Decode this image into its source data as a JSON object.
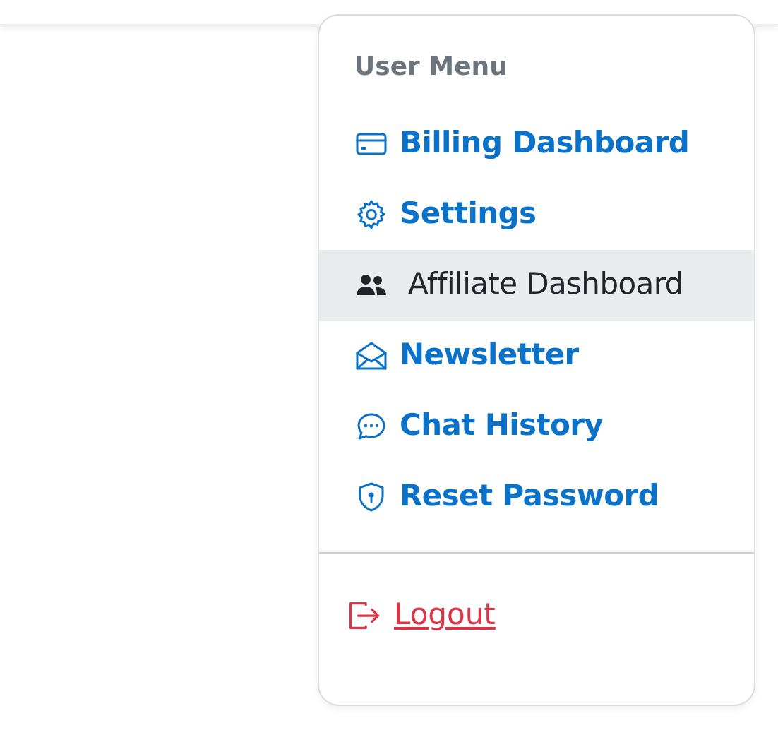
{
  "menu": {
    "header": "User Menu",
    "items": [
      {
        "label": "Billing Dashboard",
        "selected": false
      },
      {
        "label": "Settings",
        "selected": false
      },
      {
        "label": "Affiliate Dashboard",
        "selected": true
      },
      {
        "label": "Newsletter",
        "selected": false
      },
      {
        "label": "Chat History",
        "selected": false
      },
      {
        "label": "Reset Password",
        "selected": false
      }
    ],
    "logout": {
      "label": "Logout"
    }
  }
}
